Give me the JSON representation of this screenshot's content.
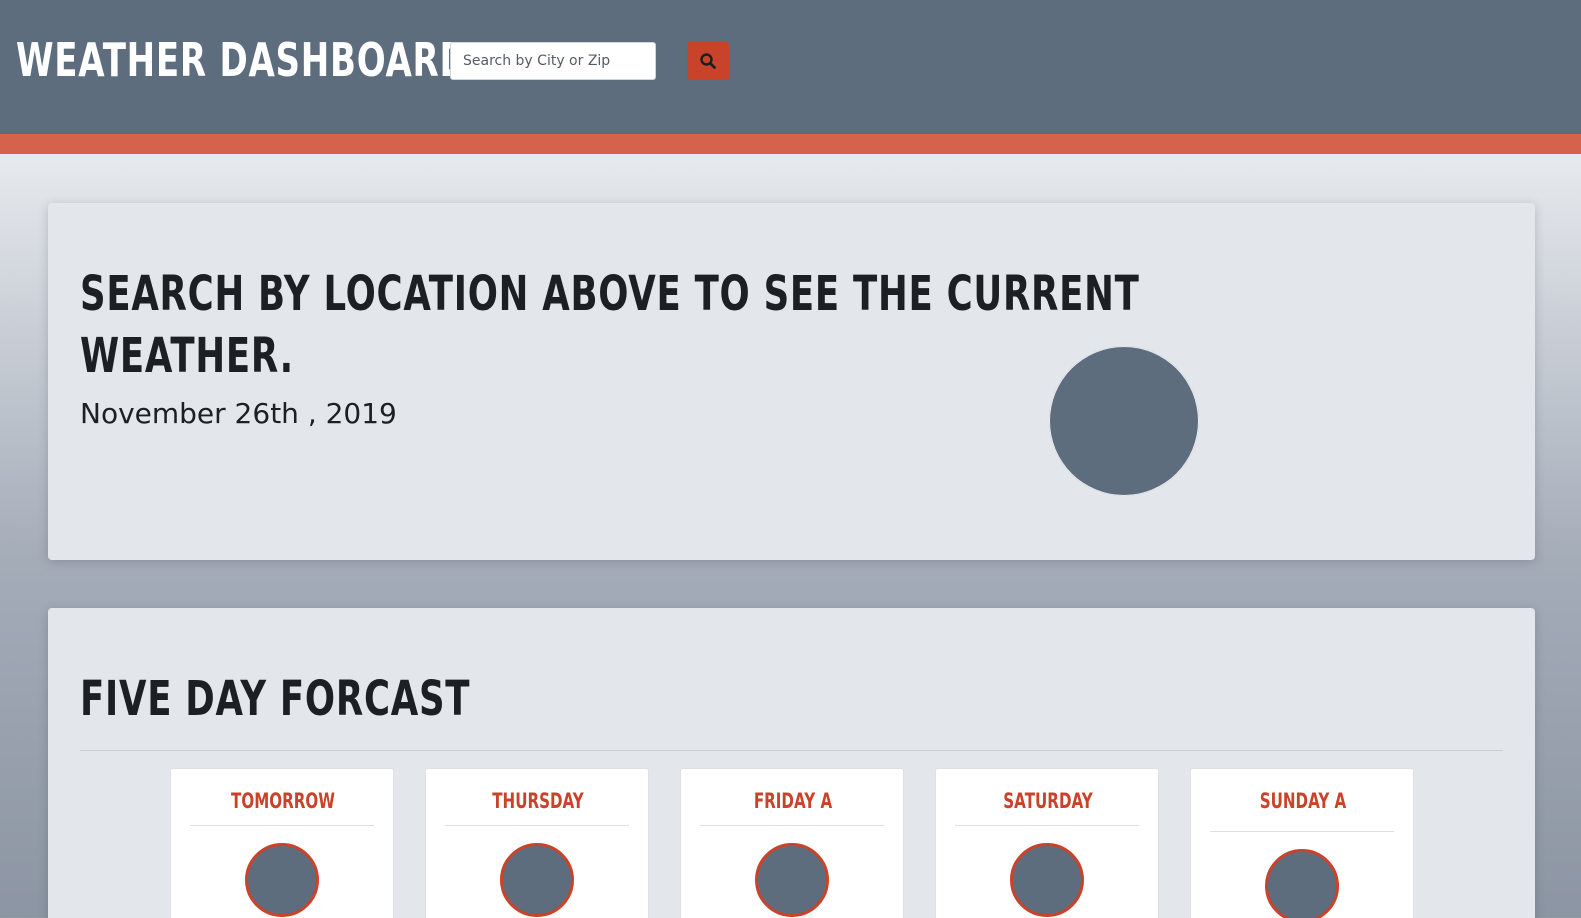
{
  "header": {
    "title": "Weather Dashboard",
    "search": {
      "placeholder": "Search by City or Zip",
      "value": ""
    },
    "search_button_icon": "search-icon"
  },
  "current": {
    "title_line1": "Search by location above to see the current",
    "title_line2": "weather.",
    "date": "November 26th , 2019",
    "icon": "weather-icon-placeholder"
  },
  "forecast": {
    "title": "Five Day Forcast",
    "days": [
      {
        "label": "Tomorrow",
        "icon": "weather-icon-placeholder"
      },
      {
        "label": "Thursday",
        "icon": "weather-icon-placeholder"
      },
      {
        "label": "Friday A",
        "icon": "weather-icon-placeholder"
      },
      {
        "label": "Saturday",
        "icon": "weather-icon-placeholder"
      },
      {
        "label": "Sunday A",
        "icon": "weather-icon-placeholder"
      }
    ]
  },
  "colors": {
    "header_bg": "#5d6d7e",
    "accent": "#d5634b",
    "button": "#c9432a",
    "card_bg": "#e3e6eb",
    "day_label": "#c9432a"
  }
}
